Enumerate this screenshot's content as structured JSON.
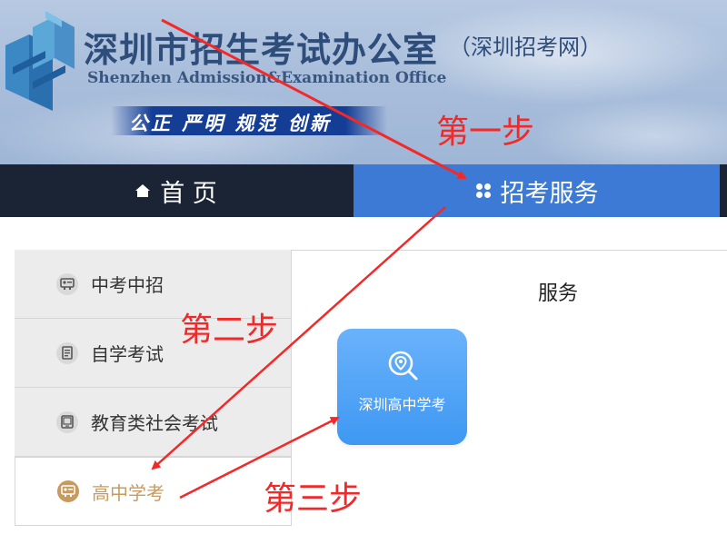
{
  "header": {
    "org_name": "深圳市招生考试办公室",
    "org_site": "（深圳招考网）",
    "org_name_en": "Shenzhen Admission&Examination Office",
    "slogan": "公正 严明 规范 创新"
  },
  "nav": {
    "items": [
      {
        "label": "首 页",
        "icon": "home-icon"
      },
      {
        "label": "招考服务",
        "icon": "grid-icon",
        "active": true
      }
    ]
  },
  "sidebar": {
    "items": [
      {
        "label": "中考中招",
        "icon": "id-card-icon"
      },
      {
        "label": "自学考试",
        "icon": "document-icon"
      },
      {
        "label": "教育类社会考试",
        "icon": "tablet-icon"
      },
      {
        "label": "高中学考",
        "icon": "id-card-icon",
        "active": true
      }
    ]
  },
  "main": {
    "section_title": "服务",
    "services": [
      {
        "label": "深圳高中学考",
        "icon": "search-location-icon"
      }
    ]
  },
  "annotations": {
    "step1": "第一步",
    "step2": "第二步",
    "step3": "第三步",
    "color": "#f52828"
  },
  "colors": {
    "nav_bg": "#1b2434",
    "nav_active": "#3c7ad6",
    "tile": "#4da3f6",
    "active_label": "#c89a5d"
  }
}
